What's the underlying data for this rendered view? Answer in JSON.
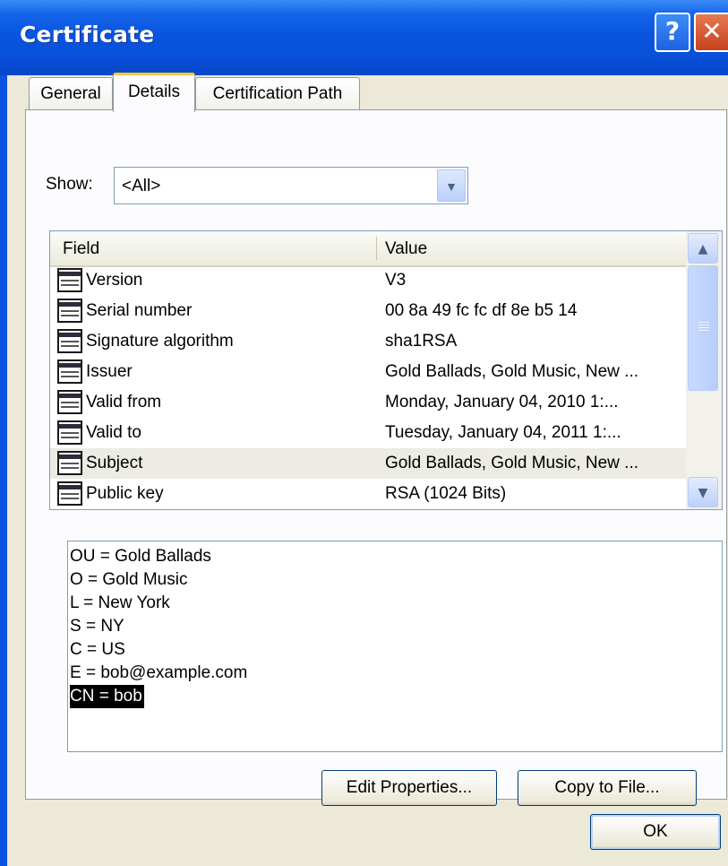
{
  "window": {
    "title": "Certificate",
    "help_glyph": "?",
    "close_glyph": "✕"
  },
  "tabs": [
    {
      "label": "General"
    },
    {
      "label": "Details"
    },
    {
      "label": "Certification Path"
    }
  ],
  "show": {
    "label": "Show:",
    "selected": "<All>",
    "arrow": "▼"
  },
  "list": {
    "columns": {
      "field": "Field",
      "value": "Value"
    },
    "rows": [
      {
        "field": "Version",
        "value": "V3"
      },
      {
        "field": "Serial number",
        "value": "00 8a 49 fc fc df 8e b5 14"
      },
      {
        "field": "Signature algorithm",
        "value": "sha1RSA"
      },
      {
        "field": "Issuer",
        "value": "Gold Ballads, Gold Music, New ..."
      },
      {
        "field": "Valid from",
        "value": "Monday, January 04, 2010 1:..."
      },
      {
        "field": "Valid to",
        "value": "Tuesday, January 04, 2011 1:..."
      },
      {
        "field": "Subject",
        "value": "Gold Ballads, Gold Music, New ..."
      },
      {
        "field": "Public key",
        "value": "RSA (1024 Bits)"
      }
    ],
    "selected_field": "Subject",
    "scroll_up": "▲",
    "scroll_down": "▼"
  },
  "detail": {
    "lines": [
      "OU = Gold Ballads",
      "O = Gold Music",
      "L = New York",
      "S = NY",
      "C = US",
      "E = bob@example.com",
      "CN = bob"
    ],
    "highlighted": "CN = bob"
  },
  "buttons": {
    "edit_properties": "Edit Properties...",
    "copy_to_file": "Copy to File...",
    "ok": "OK"
  }
}
